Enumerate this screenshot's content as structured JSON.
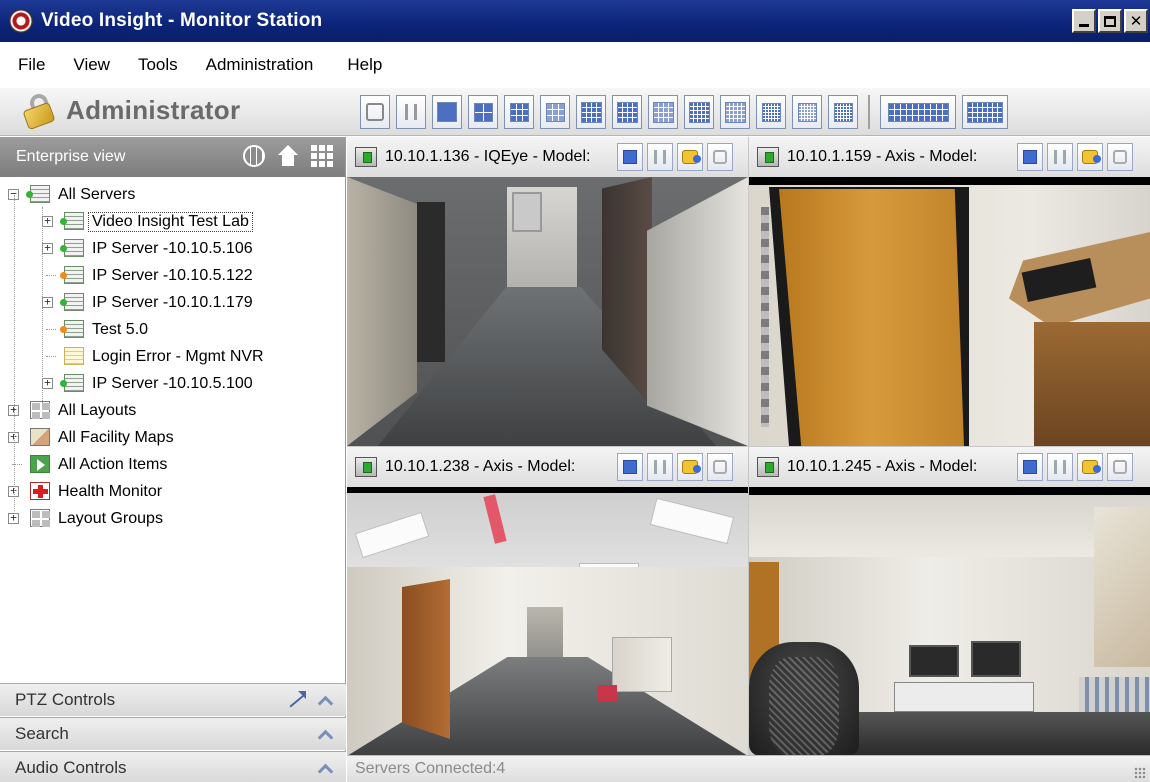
{
  "window": {
    "title": "Video Insight - Monitor Station",
    "min_label": "",
    "max_label": "",
    "close_label": "✕"
  },
  "menu": {
    "items": [
      "File",
      "View",
      "Tools",
      "Administration",
      "Help"
    ]
  },
  "user": {
    "role": "Administrator"
  },
  "left_panel": {
    "header": "Enterprise view",
    "header_icons": [
      "globe-icon",
      "home-icon",
      "grid-icon"
    ],
    "tree": [
      {
        "label": "All Servers",
        "icon": "server-icon",
        "status": "green",
        "expander": "−"
      },
      {
        "label": "Video Insight Test Lab",
        "icon": "server-icon",
        "status": "green",
        "expander": "+",
        "selected": true
      },
      {
        "label": "IP Server -10.10.5.106",
        "icon": "server-icon",
        "status": "green",
        "expander": "+"
      },
      {
        "label": "IP Server -10.10.5.122",
        "icon": "server-icon",
        "status": "orange",
        "expander": ""
      },
      {
        "label": "IP Server -10.10.1.179",
        "icon": "server-icon",
        "status": "green",
        "expander": "+"
      },
      {
        "label": "Test 5.0",
        "icon": "server-icon",
        "status": "orange",
        "expander": ""
      },
      {
        "label": "Login Error - Mgmt NVR",
        "icon": "server-icon",
        "status": "yellow",
        "expander": ""
      },
      {
        "label": "IP Server -10.10.5.100",
        "icon": "server-icon",
        "status": "green",
        "expander": "+"
      },
      {
        "label": "All Layouts",
        "icon": "layout-icon",
        "expander": "+"
      },
      {
        "label": "All Facility Maps",
        "icon": "map-icon",
        "expander": "+"
      },
      {
        "label": "All Action Items",
        "icon": "action-icon",
        "expander": ""
      },
      {
        "label": "Health Monitor",
        "icon": "health-icon",
        "expander": "+"
      },
      {
        "label": "Layout Groups",
        "icon": "layout-icon",
        "expander": "+"
      }
    ],
    "sections": [
      "PTZ Controls",
      "Search",
      "Audio Controls"
    ]
  },
  "cameras": [
    {
      "title": "10.10.1.136 - IQEye - Model:",
      "scene": "hallway"
    },
    {
      "title": "10.10.1.159 - Axis - Model:",
      "scene": "office-door"
    },
    {
      "title": "10.10.1.238 - Axis - Model:",
      "scene": "wide-hallway"
    },
    {
      "title": "10.10.1.245 - Axis - Model:",
      "scene": "office-monitors"
    }
  ],
  "status": {
    "text": "Servers Connected:4"
  },
  "colors": {
    "titlebar": "#0b2478",
    "tile_blue": "#3f6ad0",
    "status_green": "#35b335",
    "status_orange": "#f08a1a"
  }
}
